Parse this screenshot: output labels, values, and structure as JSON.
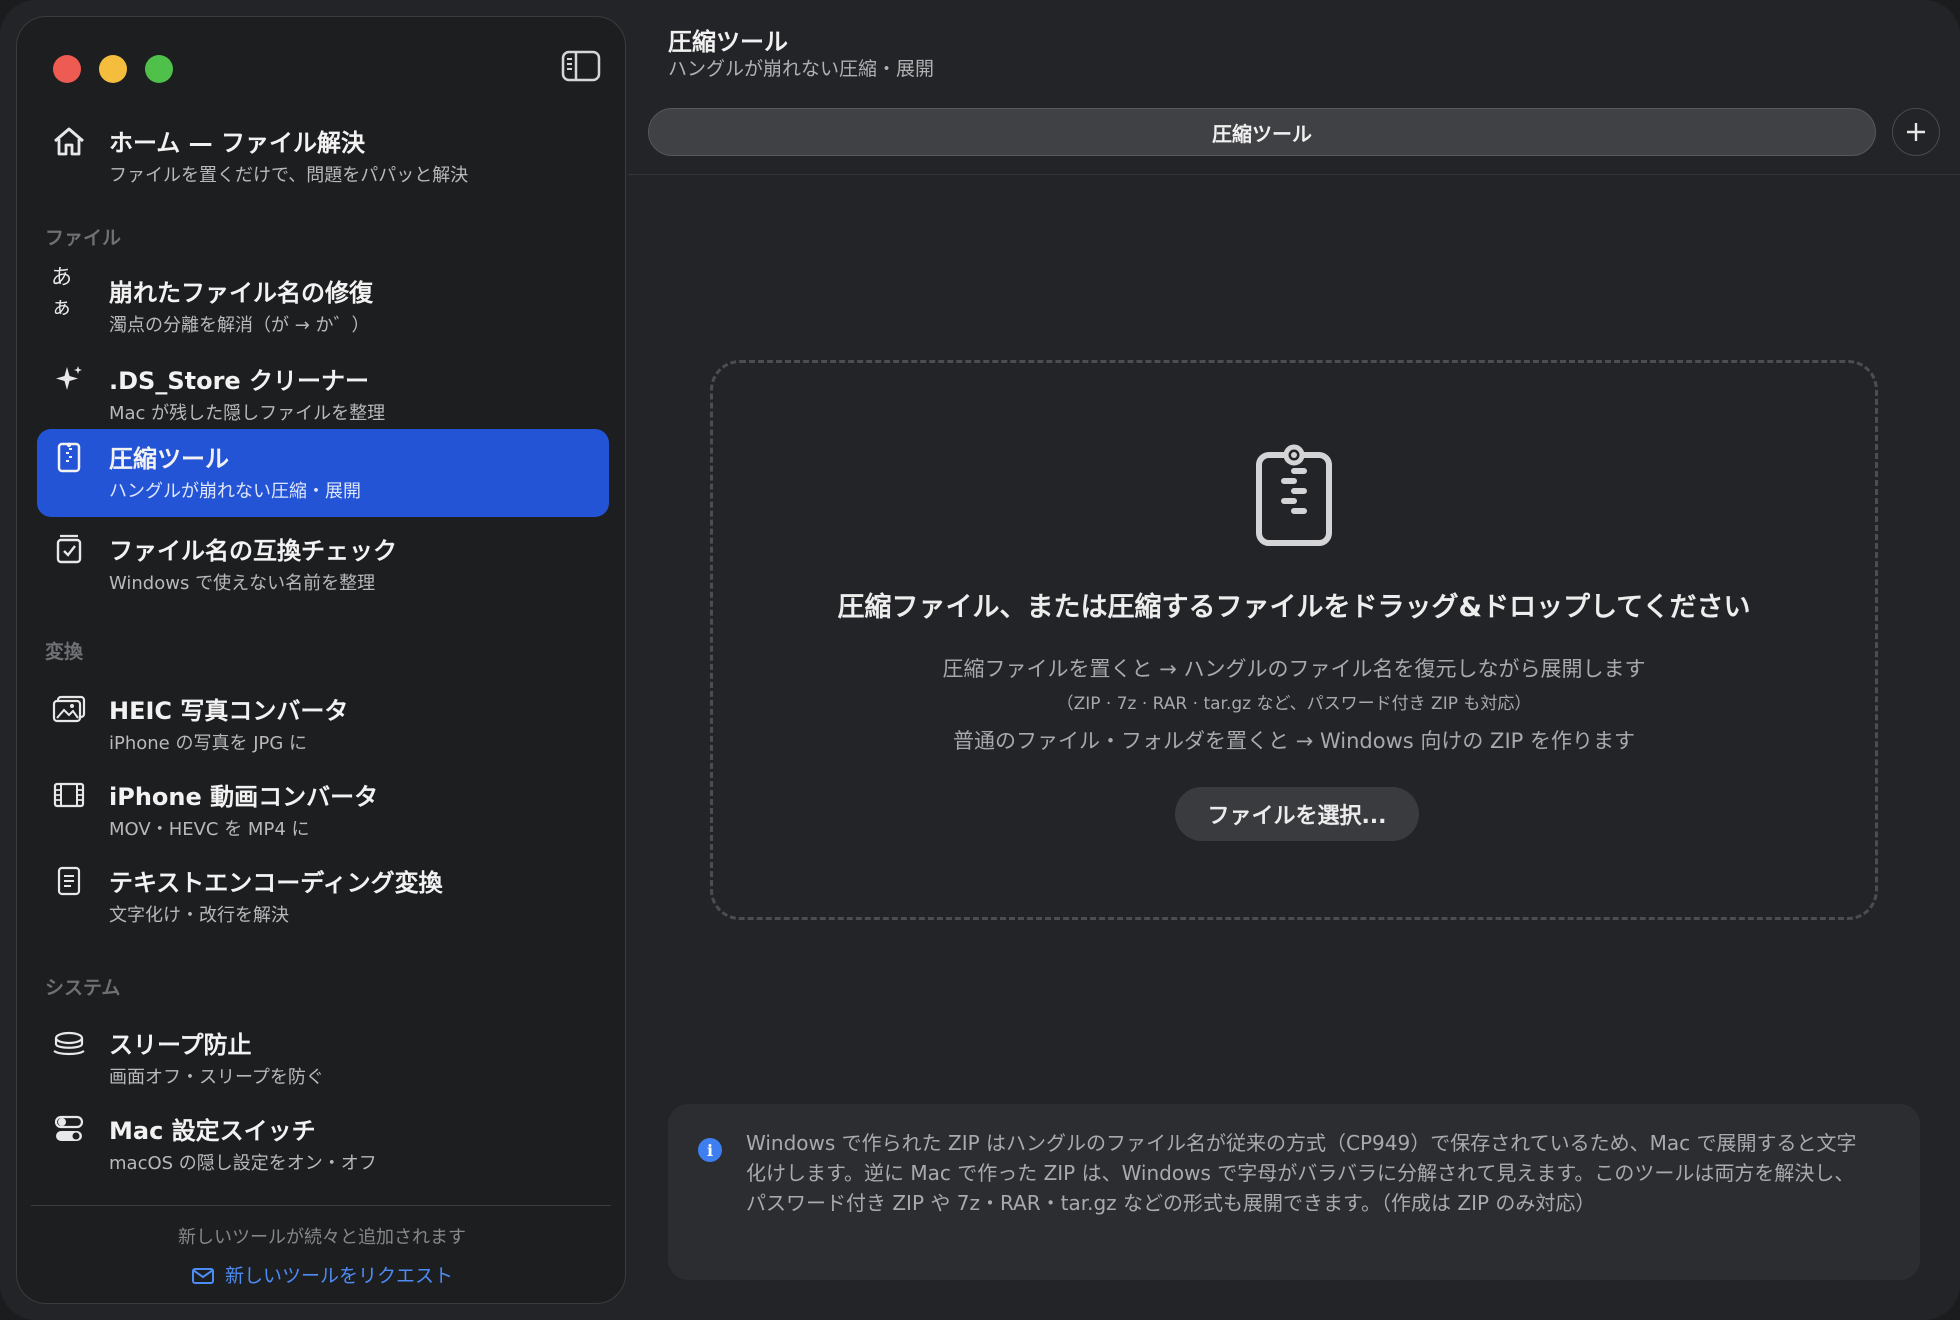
{
  "window": {
    "traffic_lights": [
      "close",
      "minimize",
      "zoom"
    ]
  },
  "sidebar": {
    "toggle_icon": "sidebar-toggle-icon",
    "home": {
      "icon": "house-icon",
      "title": "ホーム — ファイル解決",
      "subtitle": "ファイルを置くだけで、問題をパパッと解決"
    },
    "sections": [
      {
        "label": "ファイル",
        "items": [
          {
            "icon": "hiragana-icon",
            "icon_text": "あぁ",
            "title": "崩れたファイル名の修復",
            "subtitle": "濁点の分離を解消（が → か゛）"
          },
          {
            "icon": "sparkle-icon",
            "title": ".DS_Store クリーナー",
            "subtitle": "Mac が残した隠しファイルを整理"
          },
          {
            "icon": "zip-icon",
            "title": "圧縮ツール",
            "subtitle": "ハングルが崩れない圧縮・展開",
            "selected": true
          },
          {
            "icon": "checklist-icon",
            "title": "ファイル名の互換チェック",
            "subtitle": "Windows で使えない名前を整理"
          }
        ]
      },
      {
        "label": "変換",
        "items": [
          {
            "icon": "photo-icon",
            "title": "HEIC 写真コンバータ",
            "subtitle": "iPhone の写真を JPG に"
          },
          {
            "icon": "film-icon",
            "title": "iPhone 動画コンバータ",
            "subtitle": "MOV・HEVC を MP4 に"
          },
          {
            "icon": "document-icon",
            "title": "テキストエンコーディング変換",
            "subtitle": "文字化け・改行を解決"
          }
        ]
      },
      {
        "label": "システム",
        "items": [
          {
            "icon": "coffee-cup-icon",
            "title": "スリープ防止",
            "subtitle": "画面オフ・スリープを防ぐ"
          },
          {
            "icon": "switches-icon",
            "title": "Mac 設定スイッチ",
            "subtitle": "macOS の隠し設定をオン・オフ"
          }
        ]
      }
    ],
    "footer": {
      "note": "新しいツールが続々と追加されます",
      "request_icon": "envelope-icon",
      "request_label": "新しいツールをリクエスト"
    }
  },
  "main": {
    "title": "圧縮ツール",
    "subtitle": "ハングルが崩れない圧縮・展開",
    "tab_label": "圧縮ツール",
    "add_tab_icon": "plus-icon",
    "dropzone": {
      "icon": "zip-icon",
      "title": "圧縮ファイル、または圧縮するファイルをドラッグ&ドロップしてください",
      "line1": "圧縮ファイルを置くと → ハングルのファイル名を復元しながら展開します",
      "line2": "（ZIP · 7z · RAR · tar.gz など、パスワード付き ZIP も対応）",
      "line3": "普通のファイル・フォルダを置くと → Windows 向けの ZIP を作ります",
      "button_label": "ファイルを選択..."
    },
    "info": {
      "icon": "info-icon",
      "text": "Windows で作られた ZIP はハングルのファイル名が従来の方式（CP949）で保存されているため、Mac で展開すると文字化けします。逆に Mac で作った ZIP は、Windows で字母がバラバラに分解されて見えます。このツールは両方を解決し、パスワード付き ZIP や 7z・RAR・tar.gz などの形式も展開できます。（作成は ZIP のみ対応）"
    }
  },
  "colors": {
    "accent": "#2454d6",
    "link": "#4d8bf5",
    "close": "#ee5b52",
    "minimize": "#f4bd3e",
    "zoom": "#4fc04a"
  }
}
